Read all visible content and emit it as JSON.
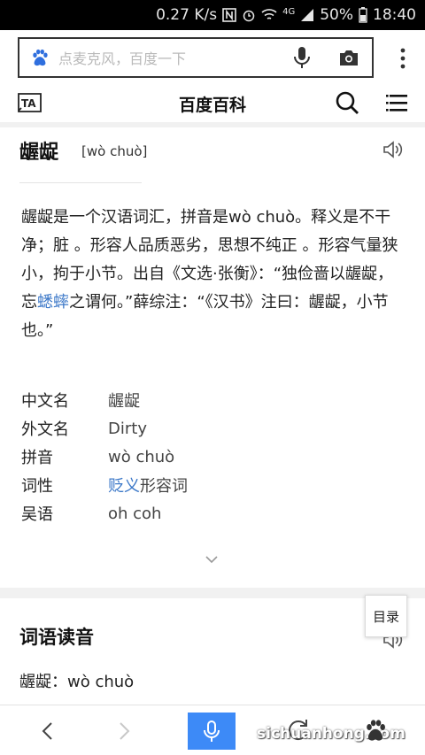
{
  "status_bar": {
    "speed": "0.27 K/s",
    "network": "4G",
    "battery": "50%",
    "time": "18:40"
  },
  "search": {
    "placeholder": "点麦克风，百度一下"
  },
  "header": {
    "title": "百度百科",
    "ta_label": "TA"
  },
  "entry": {
    "title": "龌龊",
    "pinyin": "[wò chuò]",
    "summary_part1": "龌龊是一个汉语词汇，拼音是wò chuò。释义是不干净；脏 。形容人品质恶劣，思想不纯正 。形容气量狭小，拘于小节。出自《文选·张衡》：“独俭啬以龌龊，忘",
    "summary_link": "蟋蟀",
    "summary_part2": "之谓何。”薛综注：“《汉书》注曰：龌龊，小节也。”"
  },
  "info": [
    {
      "key": "中文名",
      "value": "龌龊"
    },
    {
      "key": "外文名",
      "value": "Dirty"
    },
    {
      "key": "拼音",
      "value": "wò chuò"
    },
    {
      "key": "词性",
      "value_link": "贬义",
      "value": "形容词"
    },
    {
      "key": "吴语",
      "value": "oh coh"
    }
  ],
  "section": {
    "title": "词语读音",
    "toc_label": "目录",
    "reading": "龌龊：wò chuò"
  },
  "bottom": {
    "watermark": "sichuanhong.com"
  },
  "colors": {
    "link": "#3c78c8",
    "voice_button": "#3d8af7",
    "paw": "#2f6fde"
  }
}
